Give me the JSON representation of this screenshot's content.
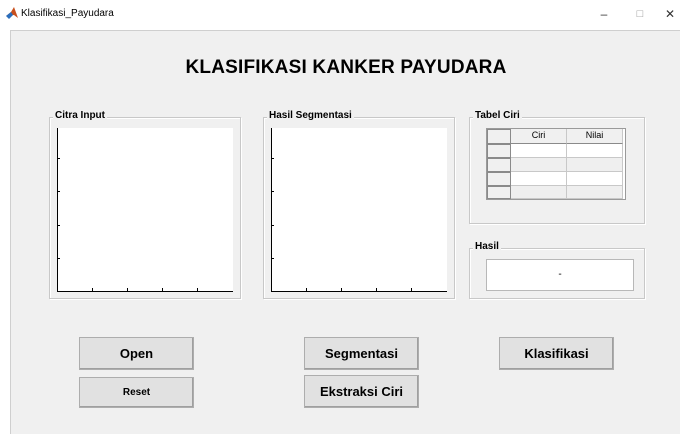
{
  "window": {
    "title": "Klasifikasi_Payudara",
    "minimize": "–",
    "maximize": "□",
    "close": "✕"
  },
  "app": {
    "title": "KLASIFIKASI KANKER PAYUDARA"
  },
  "panels": {
    "citra_input": "Citra Input",
    "hasil_segmentasi": "Hasil Segmentasi",
    "tabel_ciri": "Tabel Ciri",
    "hasil": "Hasil"
  },
  "table": {
    "columns": [
      "Ciri",
      "Nilai"
    ],
    "rows": 4
  },
  "result": {
    "value": "-"
  },
  "buttons": {
    "open": "Open",
    "reset": "Reset",
    "segmentasi": "Segmentasi",
    "ekstraksi_ciri": "Ekstraksi Ciri",
    "klasifikasi": "Klasifikasi"
  },
  "colors": {
    "background": "#f0f0f0",
    "button": "#e1e1e1",
    "axes": "#ffffff"
  }
}
